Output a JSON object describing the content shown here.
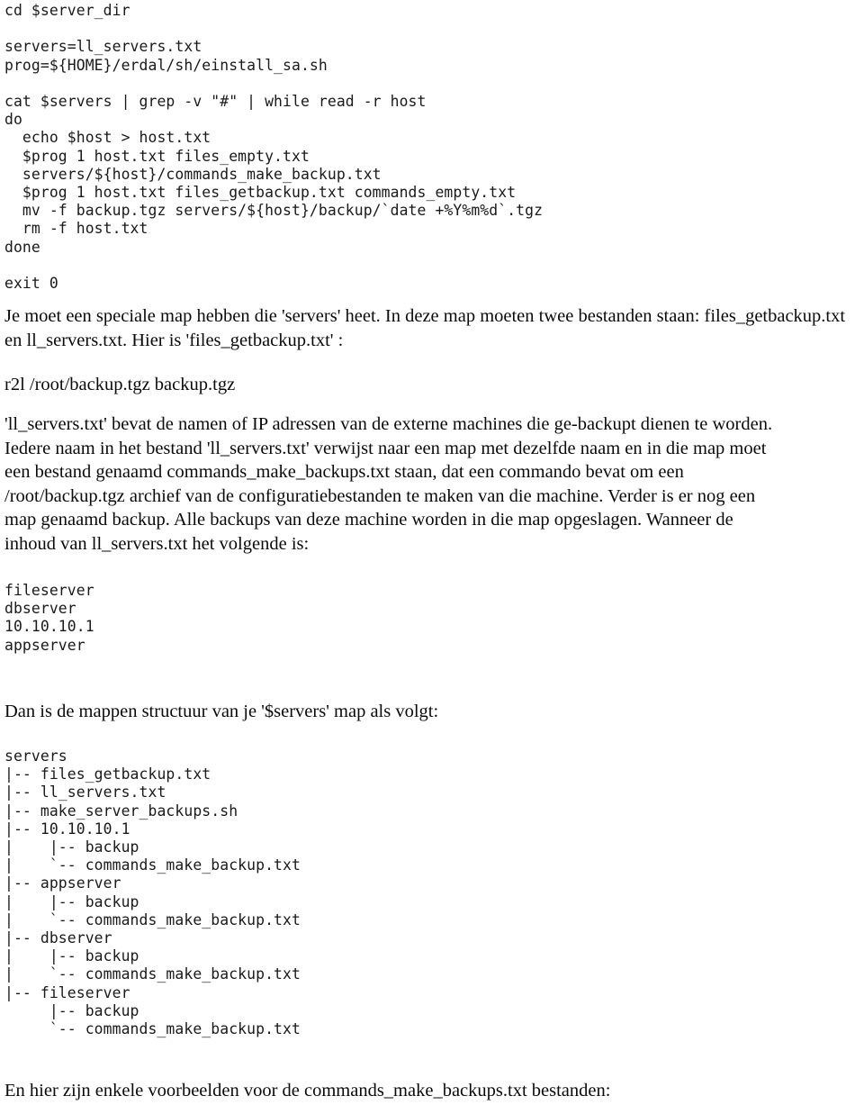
{
  "document": {
    "language": "nl",
    "code_block_script": [
      "cd $server_dir",
      "",
      "servers=ll_servers.txt",
      "prog=${HOME}/erdal/sh/einstall_sa.sh",
      "",
      "cat $servers | grep -v \"#\" | while read -r host",
      "do",
      "  echo $host > host.txt",
      "  $prog 1 host.txt files_empty.txt",
      "  servers/${host}/commands_make_backup.txt",
      "  $prog 1 host.txt files_getbackup.txt commands_empty.txt",
      "  mv -f backup.tgz servers/${host}/backup/`date +%Y%m%d`.tgz",
      "  rm -f host.txt",
      "done",
      "",
      "exit 0"
    ],
    "paragraph_intro": "Je moet een speciale map hebben die 'servers' heet. In deze map moeten twee bestanden staan: files_getbackup.txt en ll_servers.txt. Hier is 'files_getbackup.txt' :",
    "code_block_getbackup": "r2l /root/backup.tgz backup.tgz",
    "paragraph_explain_lines": [
      "'ll_servers.txt' bevat de namen of IP adressen van de externe machines die ge-backupt dienen te worden.",
      "Iedere naam in het bestand 'll_servers.txt' verwijst naar een map met dezelfde naam en in die map moet",
      "een bestand genaamd commands_make_backups.txt staan, dat een commando bevat om een",
      "/root/backup.tgz archief van de configuratiebestanden te maken van die machine. Verder is er nog een",
      "map genaamd backup. Alle backups van deze machine worden in die map opgeslagen. Wanneer de",
      "inhoud van ll_servers.txt het volgende is:"
    ],
    "code_block_llservers": [
      "fileserver",
      "dbserver",
      "10.10.10.1",
      "appserver"
    ],
    "paragraph_structure": "Dan is de mappen structuur van je '$servers' map als volgt:",
    "code_block_tree": [
      "servers",
      "|-- files_getbackup.txt",
      "|-- ll_servers.txt",
      "|-- make_server_backups.sh",
      "|-- 10.10.10.1",
      "|    |-- backup",
      "|    `-- commands_make_backup.txt",
      "|-- appserver",
      "|    |-- backup",
      "|    `-- commands_make_backup.txt",
      "|-- dbserver",
      "|    |-- backup",
      "|    `-- commands_make_backup.txt",
      "|-- fileserver",
      "     |-- backup",
      "     `-- commands_make_backup.txt"
    ],
    "paragraph_final": "En hier zijn enkele voorbeelden voor de commands_make_backups.txt bestanden:"
  }
}
